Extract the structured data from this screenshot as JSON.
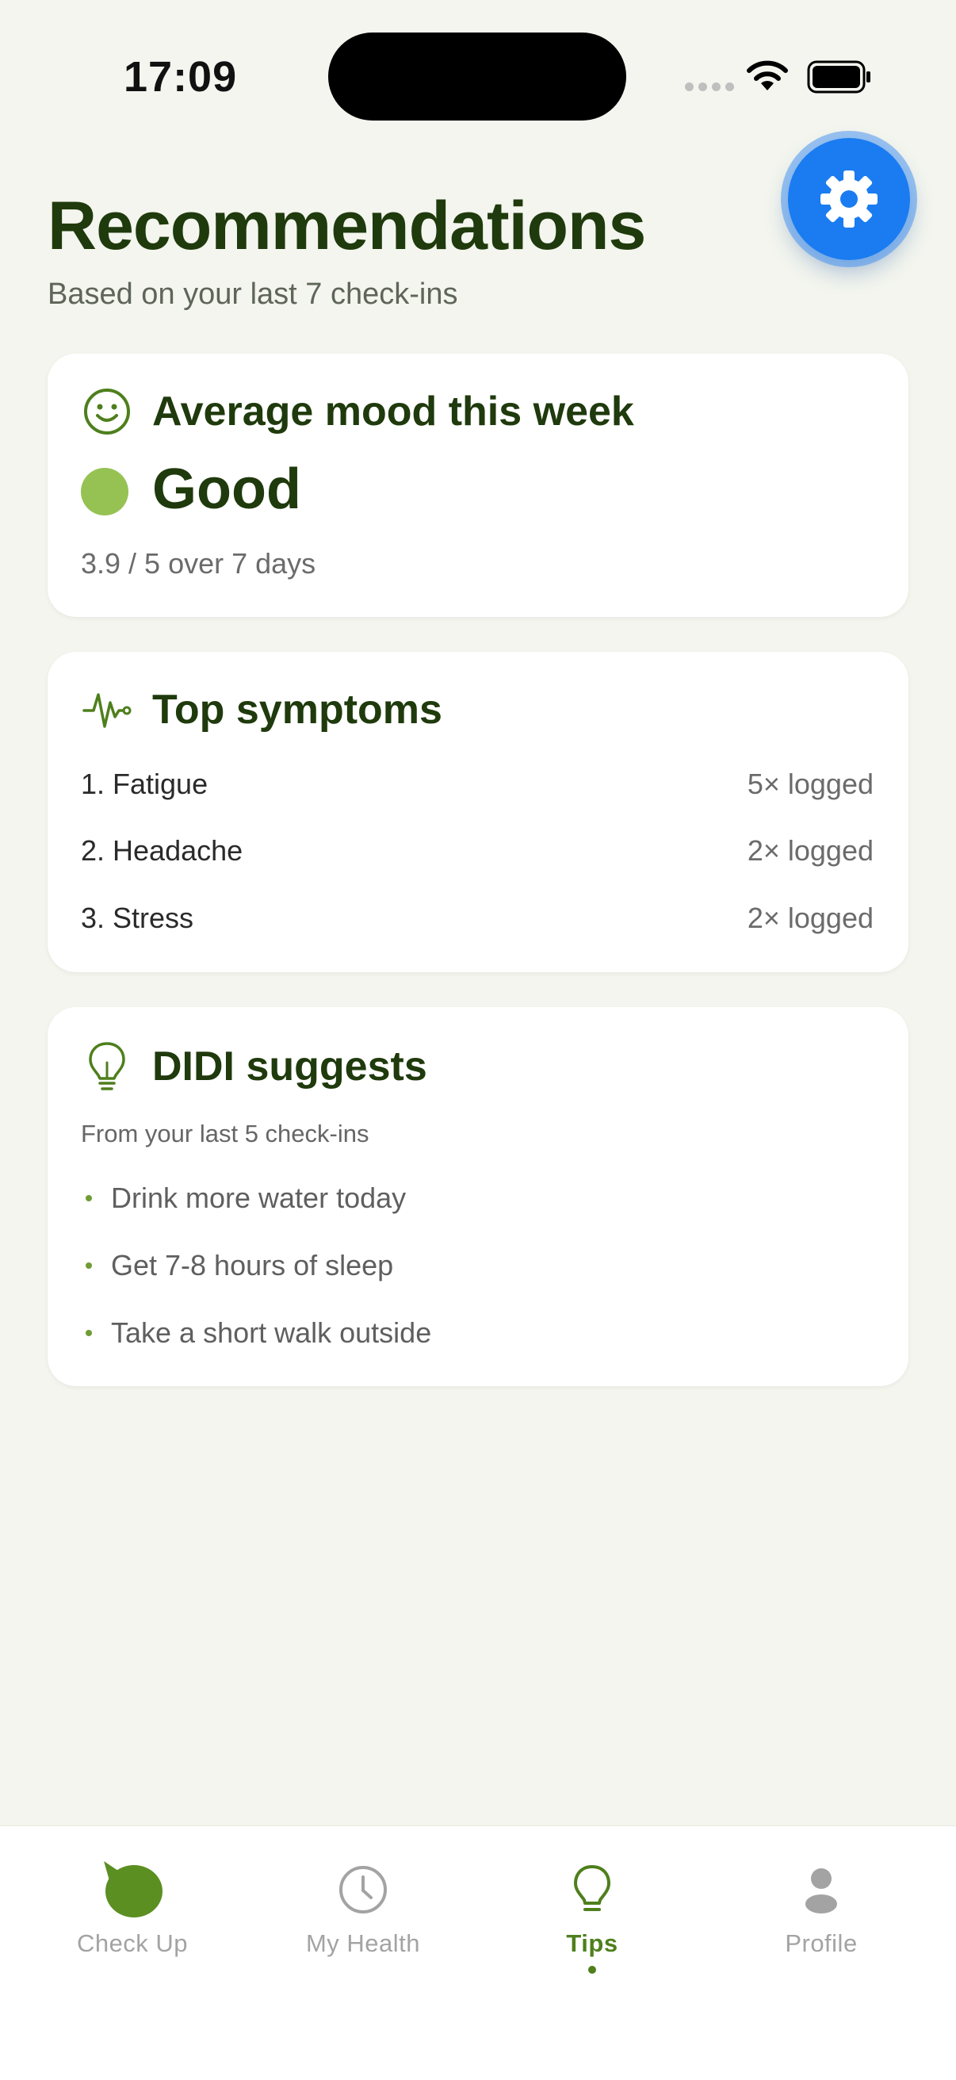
{
  "status_bar": {
    "time": "17:09"
  },
  "header": {
    "title": "Recommendations",
    "subtitle": "Based on your last 7 check-ins"
  },
  "mood_card": {
    "title": "Average mood this week",
    "mood": "Good",
    "mood_color": "#96c253",
    "detail": "3.9 / 5 over 7 days"
  },
  "symptoms_card": {
    "title": "Top symptoms",
    "items": [
      {
        "name": "1. Fatigue",
        "count": "5× logged"
      },
      {
        "name": "2. Headache",
        "count": "2× logged"
      },
      {
        "name": "3. Stress",
        "count": "2× logged"
      }
    ]
  },
  "suggest_card": {
    "title": "DIDI suggests",
    "note": "From your last 5 check-ins",
    "items": [
      "Drink more water today",
      "Get 7-8 hours of sleep",
      "Take a short walk outside"
    ]
  },
  "tabs": [
    {
      "label": "Check Up",
      "icon": "chat-bubble-icon",
      "active": false
    },
    {
      "label": "My Health",
      "icon": "clock-icon",
      "active": false
    },
    {
      "label": "Tips",
      "icon": "lightbulb-icon",
      "active": true
    },
    {
      "label": "Profile",
      "icon": "person-icon",
      "active": false
    }
  ],
  "colors": {
    "accent": "#4e7f1c",
    "title": "#1f3a0c",
    "settings_button": "#1a7cf0",
    "background": "#f3f5ee"
  }
}
